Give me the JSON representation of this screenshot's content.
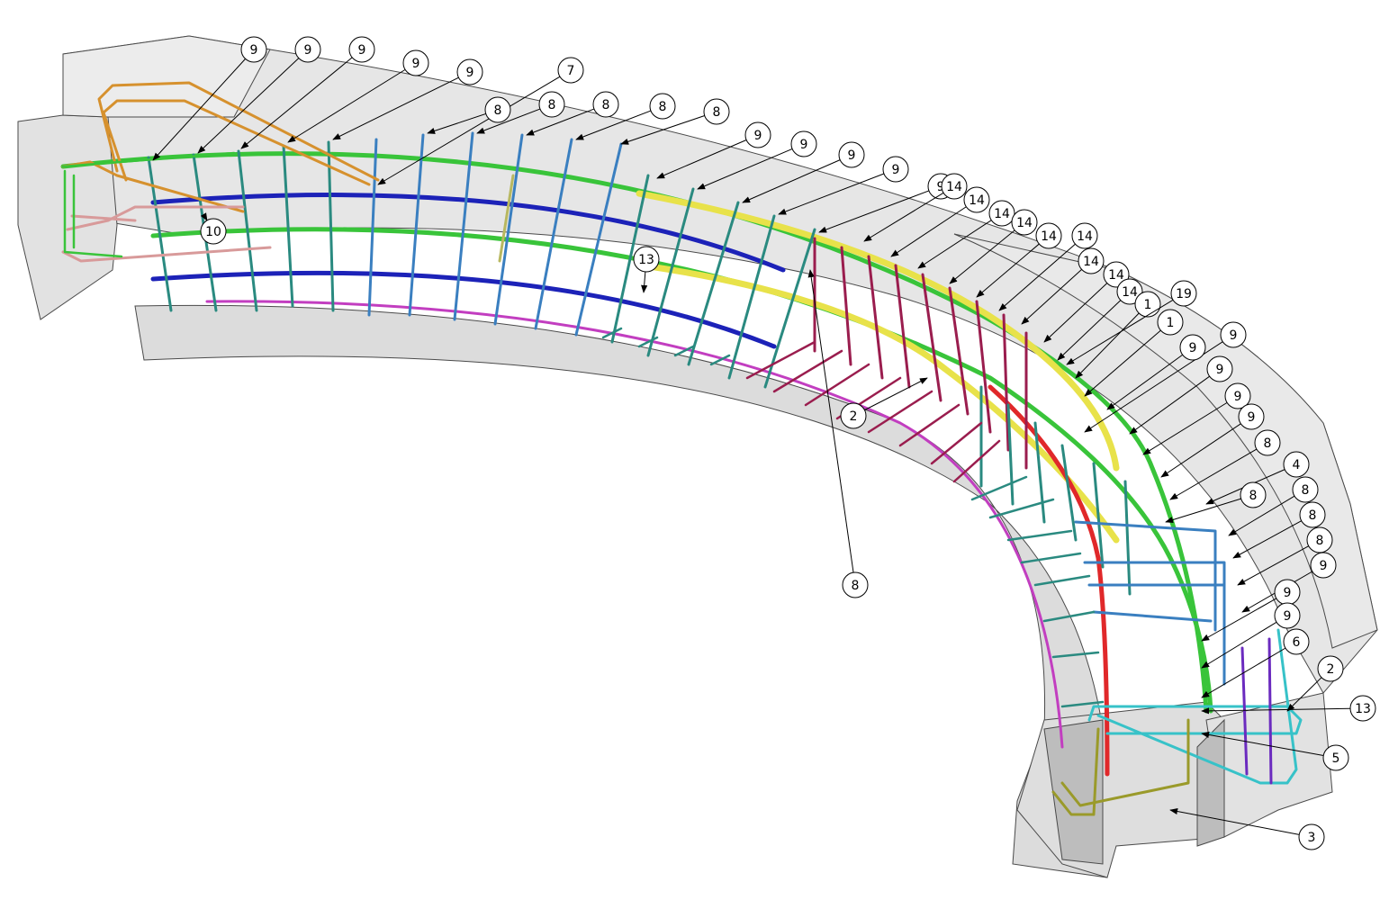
{
  "drawing": {
    "background": "#ffffff",
    "concrete_fill": "#e6e6e6",
    "concrete_edge": "#4a4a4a",
    "leader_color": "#000000",
    "colors": {
      "green": "#39c43a",
      "blue": "#1c22b8",
      "yellow": "#e8e24a",
      "red": "#e0282a",
      "magenta": "#c23ec0",
      "crimson": "#9a1d4e",
      "teal": "#2a8a80",
      "steel": "#3a7fc0",
      "orange": "#d6912e",
      "pink": "#d89a9a",
      "cyan": "#37c2c8",
      "olive": "#9a9a2a",
      "purple": "#6b2bbf"
    }
  },
  "callouts": [
    {
      "label": "9"
    },
    {
      "label": "9"
    },
    {
      "label": "9"
    },
    {
      "label": "9"
    },
    {
      "label": "9"
    },
    {
      "label": "7"
    },
    {
      "label": "8"
    },
    {
      "label": "8"
    },
    {
      "label": "8"
    },
    {
      "label": "8"
    },
    {
      "label": "8"
    },
    {
      "label": "9"
    },
    {
      "label": "9"
    },
    {
      "label": "9"
    },
    {
      "label": "9"
    },
    {
      "label": "9"
    },
    {
      "label": "14"
    },
    {
      "label": "14"
    },
    {
      "label": "14"
    },
    {
      "label": "14"
    },
    {
      "label": "14"
    },
    {
      "label": "14"
    },
    {
      "label": "14"
    },
    {
      "label": "14"
    },
    {
      "label": "14"
    },
    {
      "label": "1"
    },
    {
      "label": "19"
    },
    {
      "label": "1"
    },
    {
      "label": "9"
    },
    {
      "label": "9"
    },
    {
      "label": "9"
    },
    {
      "label": "9"
    },
    {
      "label": "9"
    },
    {
      "label": "8"
    },
    {
      "label": "4"
    },
    {
      "label": "8"
    },
    {
      "label": "8"
    },
    {
      "label": "8"
    },
    {
      "label": "8"
    },
    {
      "label": "9"
    },
    {
      "label": "9"
    },
    {
      "label": "9"
    },
    {
      "label": "6"
    },
    {
      "label": "2"
    },
    {
      "label": "13"
    },
    {
      "label": "5"
    },
    {
      "label": "3"
    },
    {
      "label": "8"
    }
  ],
  "inline_labels": [
    {
      "label": "10"
    },
    {
      "label": "13"
    },
    {
      "label": "2"
    }
  ]
}
